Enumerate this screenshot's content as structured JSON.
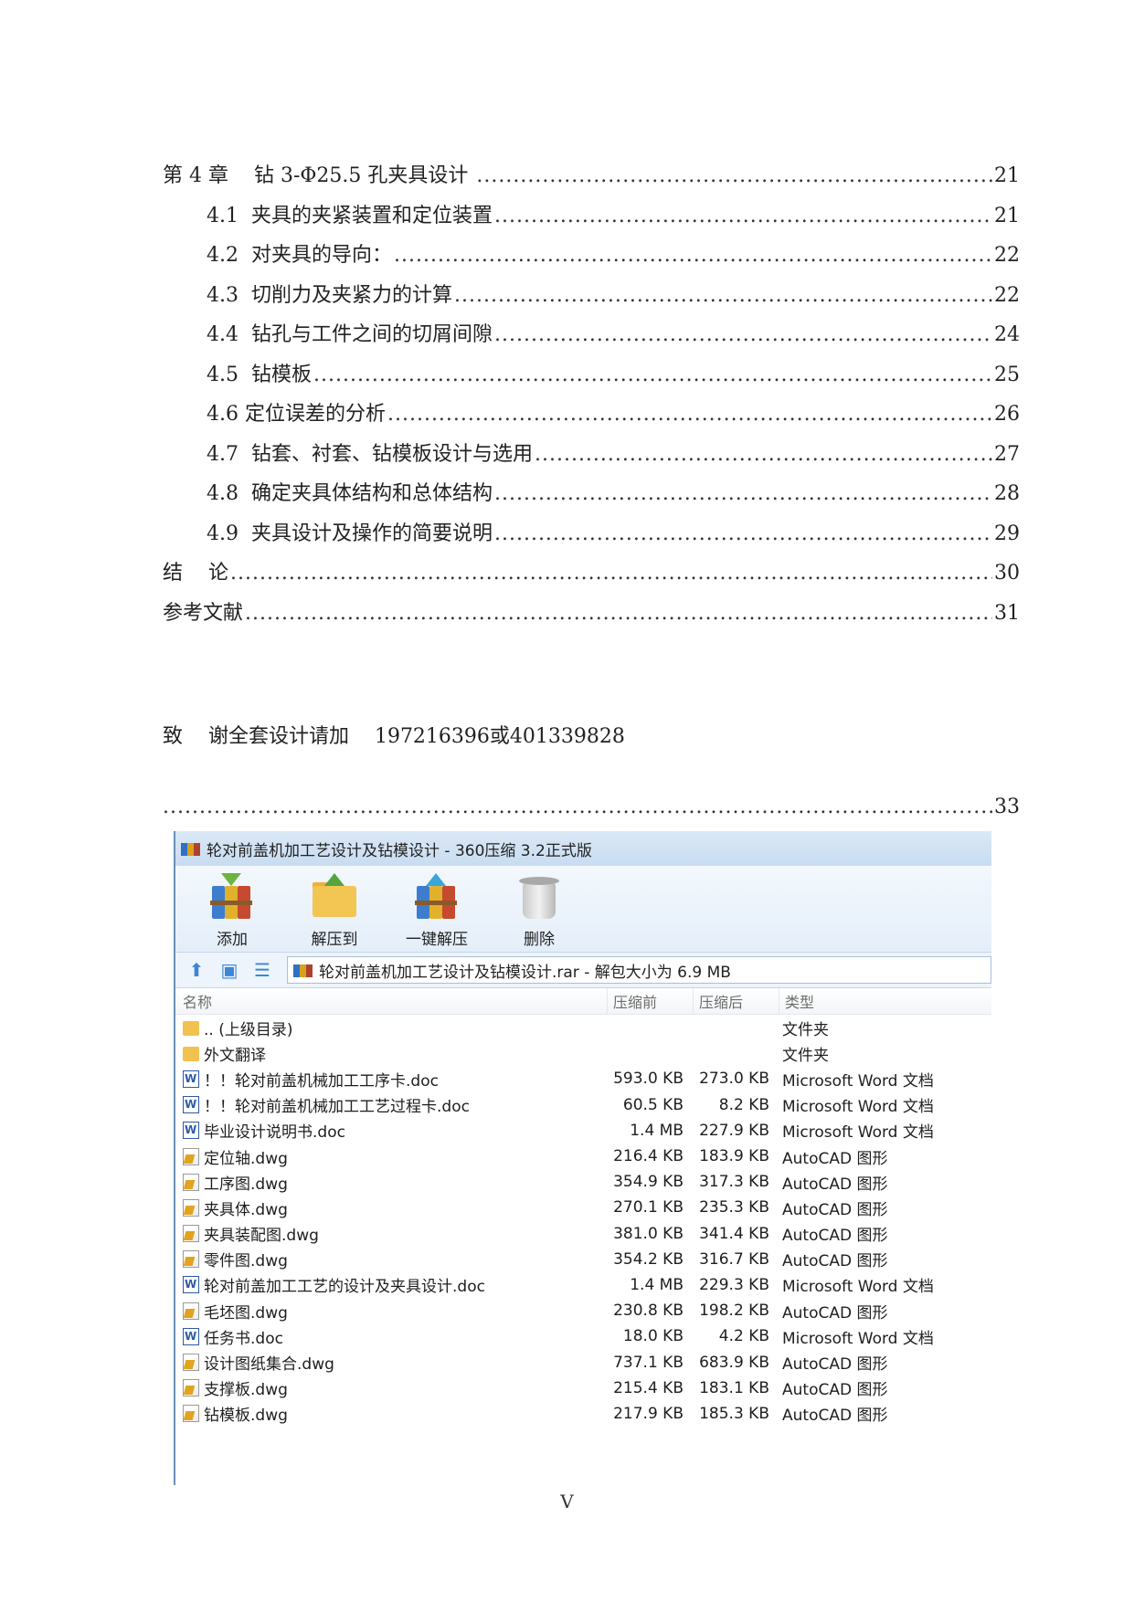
{
  "toc": {
    "entries": [
      {
        "title": "第 4 章    钻 3-Φ25.5 孔夹具设计 ",
        "page": "21",
        "level": 1
      },
      {
        "title": "4.1  夹具的夹紧装置和定位装置",
        "page": "21",
        "level": 2
      },
      {
        "title": "4.2  对夹具的导向：",
        "page": "22",
        "level": 2
      },
      {
        "title": "4.3  切削力及夹紧力的计算",
        "page": "22",
        "level": 2
      },
      {
        "title": "4.4  钻孔与工件之间的切屑间隙",
        "page": "24",
        "level": 2
      },
      {
        "title": "4.5  钻模板",
        "page": "25",
        "level": 2
      },
      {
        "title": "4.6 定位误差的分析",
        "page": "26",
        "level": 2
      },
      {
        "title": "4.7  钻套、衬套、钻模板设计与选用",
        "page": "27",
        "level": 2
      },
      {
        "title": "4.8  确定夹具体结构和总体结构",
        "page": "28",
        "level": 2
      },
      {
        "title": "4.9  夹具设计及操作的简要说明",
        "page": "29",
        "level": 2
      },
      {
        "title": "结    论",
        "page": "30",
        "level": 1
      },
      {
        "title": "参考文献",
        "page": "31",
        "level": 1
      }
    ],
    "ack_line": "致    谢全套设计请加    197216396或401339828",
    "ack_page": "33"
  },
  "window": {
    "title": "轮对前盖机加工艺设计及钻模设计 - 360压缩 3.2正式版",
    "toolbar": [
      {
        "label": "添加",
        "icon": "add-archive-icon"
      },
      {
        "label": "解压到",
        "icon": "extract-to-icon"
      },
      {
        "label": "一键解压",
        "icon": "one-click-extract-icon"
      },
      {
        "label": "删除",
        "icon": "delete-icon"
      }
    ],
    "address": "轮对前盖机加工艺设计及钻模设计.rar - 解包大小为 6.9 MB",
    "columns": {
      "name": "名称",
      "orig": "压缩前",
      "comp": "压缩后",
      "type": "类型"
    },
    "files": [
      {
        "name": ".. (上级目录)",
        "orig": "",
        "comp": "",
        "type": "文件夹",
        "icon": "folder"
      },
      {
        "name": "外文翻译",
        "orig": "",
        "comp": "",
        "type": "文件夹",
        "icon": "folder"
      },
      {
        "name": "！！轮对前盖机械加工工序卡.doc",
        "orig": "593.0 KB",
        "comp": "273.0 KB",
        "type": "Microsoft Word 文档",
        "icon": "word"
      },
      {
        "name": "！！轮对前盖机械加工工艺过程卡.doc",
        "orig": "60.5 KB",
        "comp": "8.2 KB",
        "type": "Microsoft Word 文档",
        "icon": "word"
      },
      {
        "name": "毕业设计说明书.doc",
        "orig": "1.4 MB",
        "comp": "227.9 KB",
        "type": "Microsoft Word 文档",
        "icon": "word"
      },
      {
        "name": "定位轴.dwg",
        "orig": "216.4 KB",
        "comp": "183.9 KB",
        "type": "AutoCAD 图形",
        "icon": "dwg"
      },
      {
        "name": "工序图.dwg",
        "orig": "354.9 KB",
        "comp": "317.3 KB",
        "type": "AutoCAD 图形",
        "icon": "dwg"
      },
      {
        "name": "夹具体.dwg",
        "orig": "270.1 KB",
        "comp": "235.3 KB",
        "type": "AutoCAD 图形",
        "icon": "dwg"
      },
      {
        "name": "夹具装配图.dwg",
        "orig": "381.0 KB",
        "comp": "341.4 KB",
        "type": "AutoCAD 图形",
        "icon": "dwg"
      },
      {
        "name": "零件图.dwg",
        "orig": "354.2 KB",
        "comp": "316.7 KB",
        "type": "AutoCAD 图形",
        "icon": "dwg"
      },
      {
        "name": "轮对前盖加工工艺的设计及夹具设计.doc",
        "orig": "1.4 MB",
        "comp": "229.3 KB",
        "type": "Microsoft Word 文档",
        "icon": "word"
      },
      {
        "name": "毛坯图.dwg",
        "orig": "230.8 KB",
        "comp": "198.2 KB",
        "type": "AutoCAD 图形",
        "icon": "dwg"
      },
      {
        "name": "任务书.doc",
        "orig": "18.0 KB",
        "comp": "4.2 KB",
        "type": "Microsoft Word 文档",
        "icon": "word"
      },
      {
        "name": "设计图纸集合.dwg",
        "orig": "737.1 KB",
        "comp": "683.9 KB",
        "type": "AutoCAD 图形",
        "icon": "dwg"
      },
      {
        "name": "支撑板.dwg",
        "orig": "215.4 KB",
        "comp": "183.1 KB",
        "type": "AutoCAD 图形",
        "icon": "dwg"
      },
      {
        "name": "钻模板.dwg",
        "orig": "217.9 KB",
        "comp": "185.3 KB",
        "type": "AutoCAD 图形",
        "icon": "dwg"
      }
    ]
  },
  "page_number": "V"
}
